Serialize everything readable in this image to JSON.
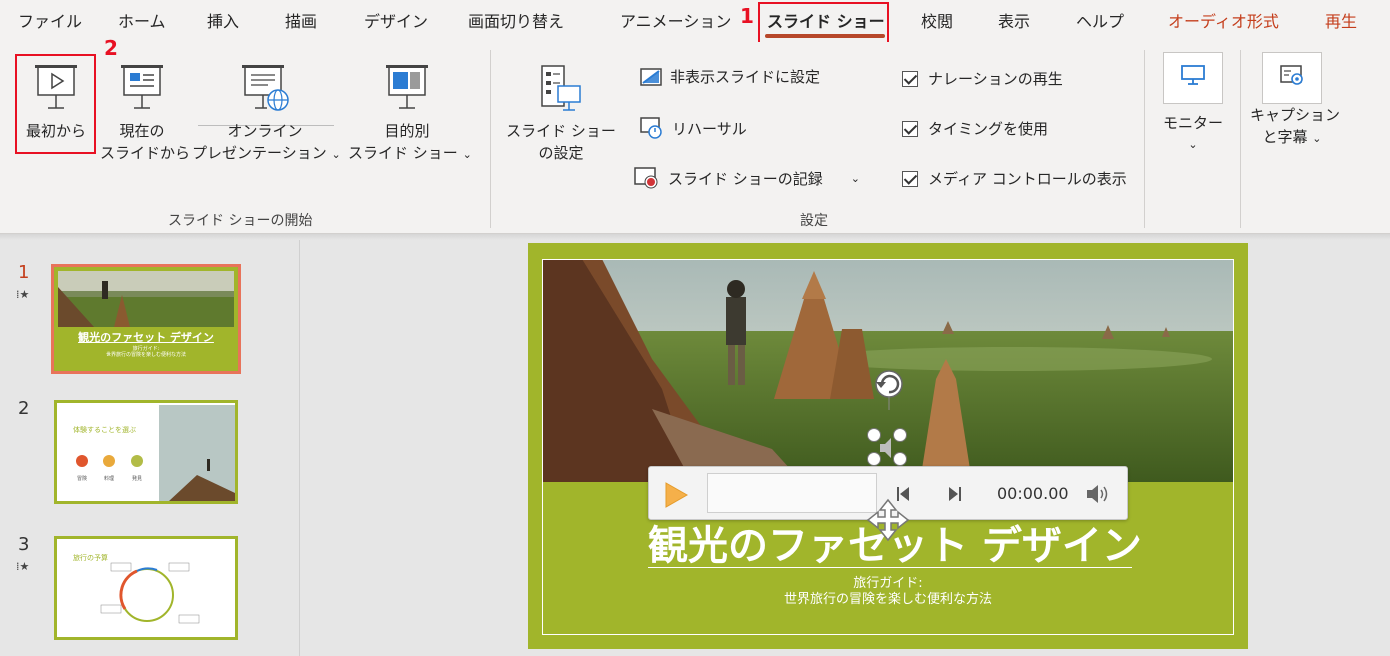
{
  "tabs": [
    {
      "label": "ファイル"
    },
    {
      "label": "ホーム"
    },
    {
      "label": "挿入"
    },
    {
      "label": "描画"
    },
    {
      "label": "デザイン"
    },
    {
      "label": "画面切り替え"
    },
    {
      "label": "アニメーション"
    },
    {
      "label": "スライド ショー"
    },
    {
      "label": "校閲"
    },
    {
      "label": "表示"
    },
    {
      "label": "ヘルプ"
    },
    {
      "label": "オーディオ形式"
    },
    {
      "label": "再生"
    }
  ],
  "annotations": {
    "step1": "1",
    "step2": "2"
  },
  "ribbon": {
    "start_group": {
      "label": "スライド ショーの開始",
      "from_beginning": "最初から",
      "from_current_1": "現在の",
      "from_current_2": "スライドから",
      "online_1": "オンライン",
      "online_2": "プレゼンテーション",
      "custom_1": "目的別",
      "custom_2": "スライド ショー"
    },
    "setup_group": {
      "label": "設定",
      "setup_1": "スライド ショー",
      "setup_2": "の設定",
      "hide_slide": "非表示スライドに設定",
      "rehearse": "リハーサル",
      "record": "スライド ショーの記録",
      "narration": "ナレーションの再生",
      "timing": "タイミングを使用",
      "media_controls": "メディア コントロールの表示"
    },
    "monitor": "モニター",
    "captions_1": "キャプション",
    "captions_2": "と字幕"
  },
  "thumbnails": [
    {
      "number": "1",
      "title": "観光のファセット デザイン",
      "line1": "旅行ガイド:",
      "line2": "世界旅行の冒険を楽しむ便利な方法"
    },
    {
      "number": "2",
      "title": "体験することを選ぶ",
      "c1": "冒険",
      "c2": "料理",
      "c3": "発見"
    },
    {
      "number": "3",
      "title": "旅行の予算"
    }
  ],
  "slide": {
    "title": "観光のファセット デザイン",
    "subtitle_1": "旅行ガイド:",
    "subtitle_2": "世界旅行の冒険を楽しむ便利な方法"
  },
  "media": {
    "time": "00:00.00"
  },
  "colors": {
    "accent": "#b7472a",
    "slide_green": "#a1b52b",
    "highlight_red": "#e81123"
  }
}
